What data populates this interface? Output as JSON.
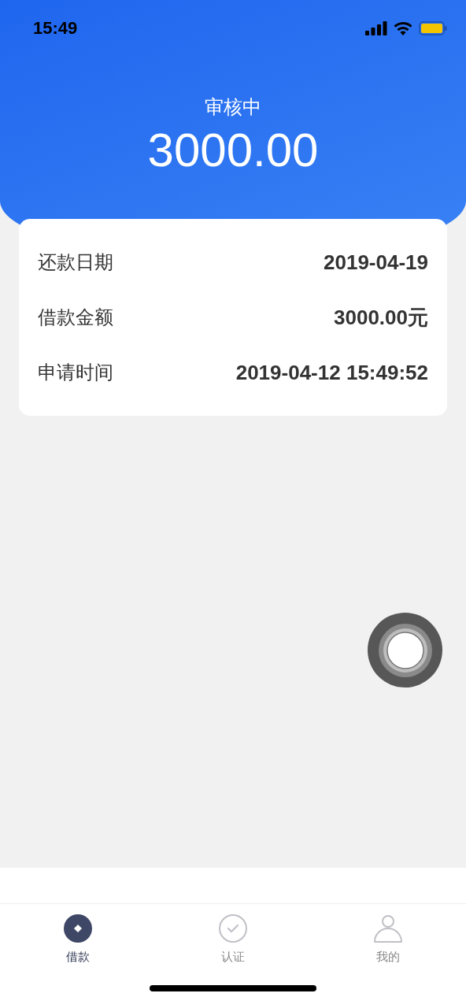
{
  "status_bar": {
    "time": "15:49"
  },
  "header": {
    "status": "审核中",
    "amount": "3000.00"
  },
  "details": [
    {
      "label": "还款日期",
      "value": "2019-04-19"
    },
    {
      "label": "借款金额",
      "value": "3000.00元"
    },
    {
      "label": "申请时间",
      "value": "2019-04-12 15:49:52"
    }
  ],
  "tabs": [
    {
      "label": "借款",
      "kind": "diamond",
      "selected": true
    },
    {
      "label": "认证",
      "kind": "check",
      "selected": false
    },
    {
      "label": "我的",
      "kind": "person",
      "selected": false
    }
  ]
}
